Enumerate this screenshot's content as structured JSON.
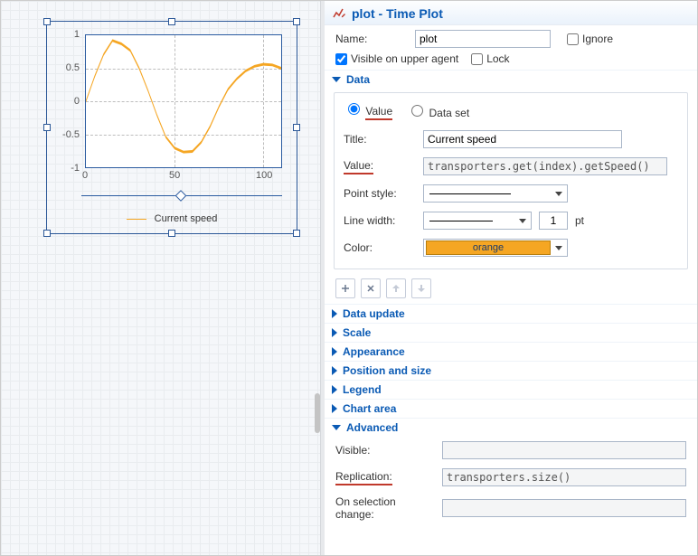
{
  "header": {
    "object_name": "plot",
    "type_label": "Time Plot",
    "title_sep": " - "
  },
  "icons": {
    "header": "chart-line-edit-icon"
  },
  "general": {
    "name_label": "Name:",
    "name_value": "plot",
    "ignore_label": "Ignore",
    "ignore_checked": false,
    "visible_upper_label": "Visible on upper agent",
    "visible_upper_checked": true,
    "lock_label": "Lock",
    "lock_checked": false
  },
  "sections": {
    "data": {
      "label": "Data",
      "open": true
    },
    "data_update": {
      "label": "Data update",
      "open": false
    },
    "scale": {
      "label": "Scale",
      "open": false
    },
    "appearance": {
      "label": "Appearance",
      "open": false
    },
    "position_size": {
      "label": "Position and size",
      "open": false
    },
    "legend": {
      "label": "Legend",
      "open": false
    },
    "chart_area": {
      "label": "Chart area",
      "open": false
    },
    "advanced": {
      "label": "Advanced",
      "open": true
    }
  },
  "data": {
    "radio_value_label": "Value",
    "radio_dataset_label": "Data set",
    "radio_selected": "value",
    "title_label": "Title:",
    "title_value": "Current speed",
    "value_label": "Value:",
    "value_expr": "transporters.get(index).getSpeed()",
    "point_style_label": "Point style:",
    "line_width_label": "Line width:",
    "line_width_value": "1",
    "line_width_unit": "pt",
    "color_label": "Color:",
    "color_name": "orange",
    "color_hex": "#F5A623"
  },
  "tools": {
    "add": "+",
    "remove": "✕",
    "up": "⇧",
    "down": "⇩"
  },
  "advanced": {
    "visible_label": "Visible:",
    "visible_value": "",
    "replication_label": "Replication:",
    "replication_value": "transporters.size()",
    "on_sel_change_label": "On selection change:",
    "on_sel_change_value": ""
  },
  "chart_data": {
    "type": "line",
    "title": "",
    "xlabel": "",
    "ylabel": "",
    "xlim": [
      0,
      110
    ],
    "ylim": [
      -1,
      1
    ],
    "x_ticks": [
      0,
      50,
      100
    ],
    "y_ticks": [
      -1,
      -0.5,
      0,
      0.5,
      1
    ],
    "series": [
      {
        "name": "Current speed",
        "color": "#F5A623",
        "x": [
          0,
          5,
          10,
          15,
          20,
          25,
          30,
          35,
          40,
          45,
          50,
          55,
          60,
          65,
          70,
          75,
          80,
          85,
          90,
          95,
          100,
          105,
          110
        ],
        "y": [
          0,
          0.38,
          0.71,
          0.92,
          0.87,
          0.77,
          0.5,
          0.16,
          -0.21,
          -0.54,
          -0.71,
          -0.77,
          -0.76,
          -0.62,
          -0.38,
          -0.08,
          0.18,
          0.34,
          0.46,
          0.53,
          0.56,
          0.55,
          0.5
        ]
      }
    ],
    "legend": [
      "Current speed"
    ]
  }
}
